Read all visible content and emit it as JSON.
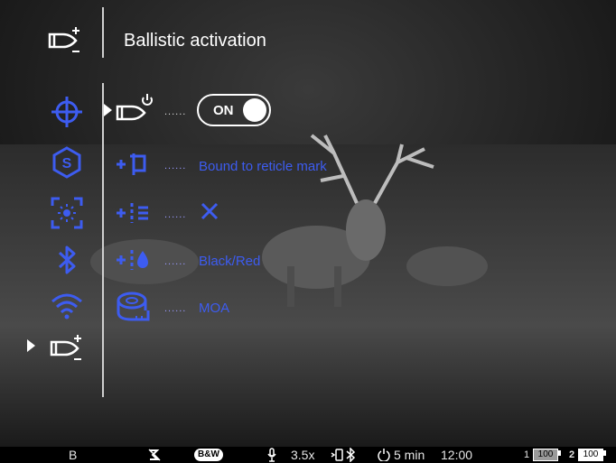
{
  "header": {
    "title": "Ballistic activation",
    "icon": "ballistic-bullet-plus-icon"
  },
  "sidebar": {
    "items": [
      {
        "icon": "crosshair-icon",
        "selected": false
      },
      {
        "icon": "hexagon-s-icon",
        "selected": false
      },
      {
        "icon": "sensor-brightness-icon",
        "selected": false
      },
      {
        "icon": "bluetooth-icon",
        "selected": false
      },
      {
        "icon": "wifi-icon",
        "selected": false
      },
      {
        "icon": "ballistic-bullet-plus-icon",
        "selected": true
      }
    ]
  },
  "rows": [
    {
      "icon": "bullet-power-icon",
      "dots": "......",
      "toggle_label": "ON",
      "selected": true
    },
    {
      "icon": "reticle-bind-icon",
      "dots": "......",
      "value": "Bound to reticle mark"
    },
    {
      "icon": "reticle-lines-icon",
      "dots": "......",
      "value": "×"
    },
    {
      "icon": "reticle-drop-icon",
      "dots": "......",
      "value": "Black/Red"
    },
    {
      "icon": "tape-measure-icon",
      "dots": "......",
      "value": "MOA"
    }
  ],
  "statusbar": {
    "mode": "B",
    "bw": "B&W",
    "zoom": "3.5x",
    "power_off": "5 min",
    "clock": "12:00",
    "battery1_index": "1",
    "battery1_level": "100",
    "battery2_index": "2",
    "battery2_level": "100"
  },
  "colors": {
    "accent": "#3d5cf0",
    "text": "#ffffff"
  }
}
